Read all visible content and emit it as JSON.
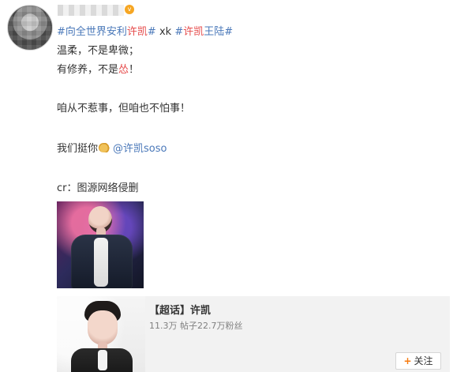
{
  "post": {
    "user": {
      "avatar_icon": "avatar-blurred",
      "name_blur": "username-blurred",
      "badge": "v"
    },
    "hashtags": {
      "part1": "#向全世界安利",
      "part1_red": "许凯",
      "part1_end": "#",
      "mid": " xk",
      "part2_start": "#",
      "part2_red": "许凯",
      "part2_end": "王陆#"
    },
    "lines": [
      "温柔，不是卑微；",
      "有修养，不是",
      "怂",
      "！",
      "咱从不惹事，但咱也不怕事！",
      "我们挺你",
      "@许凯soso",
      "cr：图源网络侵删"
    ],
    "emoji": "flexed-biceps-icon"
  },
  "card": {
    "title": "【超话】许凯",
    "stats": "11.3万 帖子22.7万粉丝",
    "follow_label": "关注",
    "follow_icon": "+"
  },
  "colors": {
    "link_blue": "#4a78b9",
    "highlight_red": "#e64b4b",
    "follow_accent": "#f77b0f",
    "card_bg": "#f2f2f2"
  }
}
